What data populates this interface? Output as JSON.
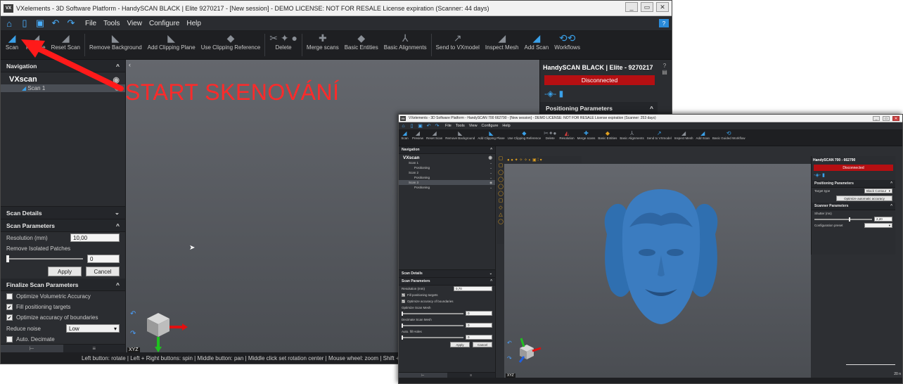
{
  "window1": {
    "title": "VXelements - 3D Software Platform - HandySCAN BLACK | Elite 9270217 - [New session] - DEMO LICENSE: NOT FOR RESALE License expiration (Scanner: 44 days)",
    "menu": [
      "File",
      "Tools",
      "View",
      "Configure",
      "Help"
    ],
    "toolbar": [
      {
        "label": "Scan",
        "icon": "scan-icon"
      },
      {
        "label": "Finalize",
        "icon": "finalize-icon"
      },
      {
        "label": "Reset Scan",
        "icon": "reset-scan-icon"
      },
      {
        "label": "Remove Background",
        "icon": "remove-background-icon"
      },
      {
        "label": "Add Clipping Plane",
        "icon": "clipping-plane-icon"
      },
      {
        "label": "Use Clipping Reference",
        "icon": "clipping-reference-icon"
      },
      {
        "label": "Delete",
        "icon": "delete-icon"
      },
      {
        "label": "Merge scans",
        "icon": "merge-icon"
      },
      {
        "label": "Basic Entities",
        "icon": "entities-icon"
      },
      {
        "label": "Basic Alignments",
        "icon": "alignments-icon"
      },
      {
        "label": "Send to VXmodel",
        "icon": "vxmodel-icon"
      },
      {
        "label": "Inspect Mesh",
        "icon": "inspect-icon"
      },
      {
        "label": "Add Scan",
        "icon": "add-scan-icon"
      },
      {
        "label": "Workflows",
        "icon": "workflows-icon"
      }
    ],
    "navigation": {
      "header": "Navigation",
      "root": "VXscan",
      "items": [
        "Scan 1"
      ]
    },
    "scan_details": {
      "header": "Scan Details",
      "params_header": "Scan Parameters",
      "resolution_label": "Resolution (mm)",
      "resolution_value": "10,00",
      "remove_patches_label": "Remove Isolated Patches",
      "slider_value": "0",
      "apply": "Apply",
      "cancel": "Cancel",
      "finalize_header": "Finalize Scan Parameters",
      "checks": [
        {
          "label": "Optimize Volumetric Accuracy",
          "checked": false
        },
        {
          "label": "Fill positioning targets",
          "checked": true
        },
        {
          "label": "Optimize accuracy of boundaries",
          "checked": true
        }
      ],
      "reduce_noise_label": "Reduce noise",
      "reduce_noise_value": "Low",
      "auto_decimate_label": "Auto. Decimate",
      "auto_decimate_checked": false
    },
    "right_panel": {
      "title": "HandySCAN BLACK | Elite - 9270217",
      "status": "Disconnected",
      "positioning_header": "Positioning Parameters"
    },
    "status_bar": "Left button: rotate  |  Left + Right buttons: spin  |  Middle button: pan  |  Middle click set rotation center  |  Mouse wheel: zoom  |  Shift + Mi",
    "axis_label": "XYZ"
  },
  "annotation": {
    "text": "START SKENOVÁNÍ",
    "color": "#ff2a2a"
  },
  "window2": {
    "title": "VXelements - 3D Software Platform - HandySCAN 700 662790 - [New session] - DEMO LICENSE: NOT FOR RESALE License expiration (Scanner: 253 days)",
    "menu": [
      "File",
      "Tools",
      "View",
      "Configure",
      "Help"
    ],
    "toolbar": [
      {
        "label": "Scan",
        "icon": "scan-icon"
      },
      {
        "label": "Preview",
        "icon": "preview-icon"
      },
      {
        "label": "Reset Scan",
        "icon": "reset-scan-icon"
      },
      {
        "label": "Remove Background",
        "icon": "remove-background-icon"
      },
      {
        "label": "Add Clipping Plane",
        "icon": "clipping-plane-icon"
      },
      {
        "label": "Use Clipping Reference",
        "icon": "clipping-reference-icon"
      },
      {
        "label": "Delete",
        "icon": "delete-icon"
      },
      {
        "label": "Resolution",
        "icon": "resolution-icon"
      },
      {
        "label": "Merge scans",
        "icon": "merge-icon"
      },
      {
        "label": "Basic Entities",
        "icon": "entities-icon"
      },
      {
        "label": "Basic Alignments",
        "icon": "alignments-icon"
      },
      {
        "label": "Send to VXmodel",
        "icon": "vxmodel-icon"
      },
      {
        "label": "Inspect Mesh",
        "icon": "inspect-icon"
      },
      {
        "label": "Add Scan",
        "icon": "add-scan-icon"
      },
      {
        "label": "Basic Guided Workflow",
        "icon": "workflow-icon"
      }
    ],
    "navigation": {
      "header": "Navigation",
      "root": "VXscan",
      "items": [
        {
          "label": "Scan 1",
          "sub": false,
          "selected": false
        },
        {
          "label": "Positioning",
          "sub": true,
          "selected": false
        },
        {
          "label": "Scan 2",
          "sub": false,
          "selected": false
        },
        {
          "label": "Positioning",
          "sub": true,
          "selected": false
        },
        {
          "label": "Scan 3",
          "sub": false,
          "selected": true
        },
        {
          "label": "Positioning",
          "sub": true,
          "selected": false
        }
      ]
    },
    "scan_details": {
      "header": "Scan Details",
      "params_header": "Scan Parameters",
      "resolution_label": "Resolution (mm)",
      "resolution_value": "0,70",
      "checks": [
        {
          "label": "Fill positioning targets",
          "checked": true
        },
        {
          "label": "Optimize accuracy of boundaries",
          "checked": true
        }
      ],
      "optimize_mesh_label": "Optimize Scan Mesh",
      "optimize_mesh_value": "0",
      "decimate_label": "Decimate Scan Mesh",
      "decimate_value": "0",
      "fill_holes_label": "Auto. fill Holes",
      "fill_holes_value": "0",
      "apply": "Apply",
      "cancel": "Cancel"
    },
    "right_panel": {
      "title": "HandySCAN 700 - 662790",
      "status": "Disconnected",
      "positioning_header": "Positioning Parameters",
      "target_type_label": "Target type",
      "target_type_value": "Black Contour",
      "optimize_button": "Optimize automatic accuracy",
      "scanner_header": "Scanner Parameters",
      "shutter_label": "Shutter (ms)",
      "shutter_value": "2,20",
      "config_label": "Configuration preset"
    },
    "scale_label": "20 n",
    "axis_label": "XYZ"
  }
}
